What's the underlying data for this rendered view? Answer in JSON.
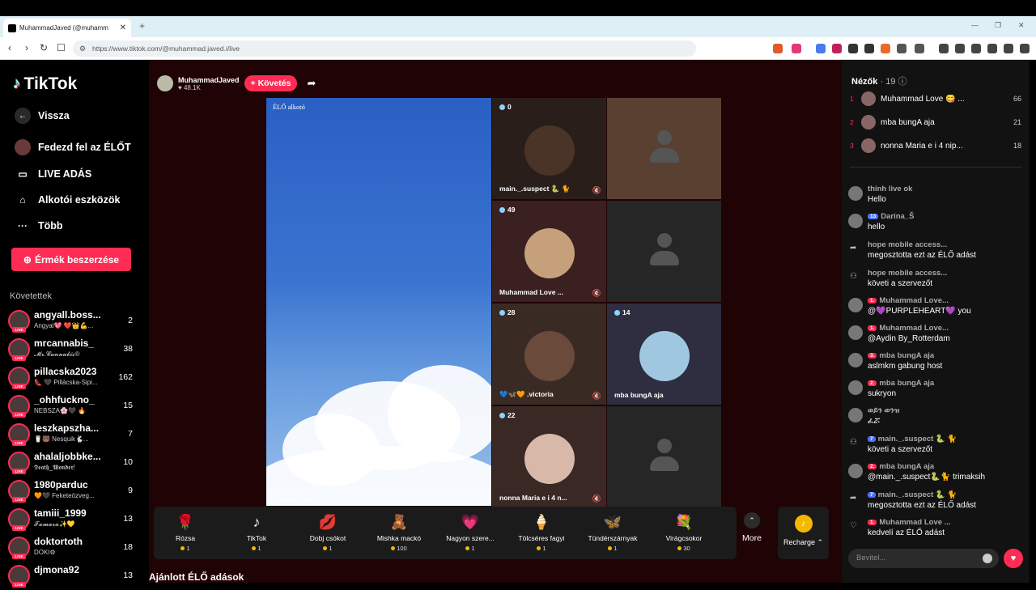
{
  "browser": {
    "tab_title": "MuhammadJaved (@muhamm",
    "url": "https://www.tiktok.com/@muhammad.javed.i/live"
  },
  "sidebar": {
    "brand": "TikTok",
    "nav": [
      "Vissza",
      "Fedezd fel az ÉLŐT",
      "LIVE ADÁS",
      "Alkotói eszközök",
      "Több"
    ],
    "coins_button": "Érmék beszerzése",
    "following_title": "Követettek",
    "following": [
      {
        "name": "angyall.boss...",
        "sub": "Angyal💖 ❤️👑💪...",
        "count": "2"
      },
      {
        "name": "mrcannabis_",
        "sub": "𝓜𝓻.𝓒𝓪𝓷𝓷𝓪𝓫𝓲𝓼®",
        "count": "38"
      },
      {
        "name": "pillacska2023",
        "sub": "👠 🖤 Pillácska-Sipi...",
        "count": "162"
      },
      {
        "name": "_ohhfuckno_",
        "sub": "NEBSZA🌸🖤 🔥",
        "count": "15"
      },
      {
        "name": "leszkapszha...",
        "sub": "🥛🐻 Nesquik🐇...",
        "count": "7"
      },
      {
        "name": "ahalaljobbke...",
        "sub": "𝕯𝖊𝖆𝖙𝖍_𝖂𝖔𝖓𝖉𝖊𝖗!",
        "count": "10"
      },
      {
        "name": "1980parduc",
        "sub": "🧡🖤 Feketeözveg...",
        "count": "9"
      },
      {
        "name": "tamiii_1999",
        "sub": "𝓣𝓪𝓶𝓪𝓻𝓪✨💛",
        "count": "13"
      },
      {
        "name": "doktortoth",
        "sub": "DOKI⚙",
        "count": "18"
      },
      {
        "name": "djmona92",
        "sub": "",
        "count": "13"
      }
    ]
  },
  "host": {
    "name": "MuhammadJaved",
    "likes": "48.1K",
    "follow_label": "+ Követés"
  },
  "stage": {
    "creator_tag": "ÉLŐ alkotó",
    "creator_name": "MuhammadJaved",
    "guests": [
      {
        "count": "0",
        "label": "main._.suspect 🐍 🐈"
      },
      {
        "count": "",
        "label": ""
      },
      {
        "count": "49",
        "label": "Muhammad Love ..."
      },
      {
        "count": "",
        "label": ""
      },
      {
        "count": "28",
        "label": "💙🦋🧡 .victoria"
      },
      {
        "count": "14",
        "label": "mba bungA aja"
      },
      {
        "count": "22",
        "label": "nonna Maria e i 4 n..."
      },
      {
        "count": "",
        "label": ""
      }
    ]
  },
  "gifts": [
    {
      "name": "Rózsa",
      "price": "1",
      "icon": "🌹"
    },
    {
      "name": "TikTok",
      "price": "1",
      "icon": "♪"
    },
    {
      "name": "Dobj csókot",
      "price": "1",
      "icon": "💋"
    },
    {
      "name": "Mishka mackó",
      "price": "100",
      "icon": "🧸"
    },
    {
      "name": "Nagyon szere...",
      "price": "1",
      "icon": "💗"
    },
    {
      "name": "Tölcséres fagyi",
      "price": "1",
      "icon": "🍦"
    },
    {
      "name": "Tündérszárnyak",
      "price": "1",
      "icon": "🦋"
    },
    {
      "name": "Virágcsokor",
      "price": "30",
      "icon": "💐"
    }
  ],
  "more_label": "More",
  "recharge_label": "Recharge",
  "recommended_title": "Ajánlott ÉLŐ adások",
  "chat": {
    "viewers_title": "Nézők",
    "viewers_count": "· 19",
    "ranking": [
      {
        "rank": "1",
        "name": "Muhammad Love 😋 ...",
        "score": "66"
      },
      {
        "rank": "2",
        "name": "mba bungA aja",
        "score": "21"
      },
      {
        "rank": "3",
        "name": "nonna Maria e i 4 nip...",
        "score": "18"
      }
    ],
    "messages": [
      {
        "user": "thinh live ok",
        "badge": "",
        "text": "Hello",
        "kind": "avatar"
      },
      {
        "user": "Darina_Š",
        "badge": "13",
        "text": "hello",
        "kind": "avatar"
      },
      {
        "user": "hope mobile access...",
        "badge": "",
        "text": "megosztotta ezt az ÉLŐ adást",
        "kind": "share"
      },
      {
        "user": "hope mobile access...",
        "badge": "",
        "text": "követi a szervezőt",
        "kind": "follow"
      },
      {
        "user": "Muhammad Love...",
        "badge": "1.",
        "text": "@💜PURPLEHEART💜 you",
        "kind": "avatar"
      },
      {
        "user": "Muhammad Love...",
        "badge": "1.",
        "text": "@Aydin By_Rotterdam",
        "kind": "avatar"
      },
      {
        "user": "mba bungA aja",
        "badge": "3.",
        "text": "aslmkm gabung host",
        "kind": "avatar"
      },
      {
        "user": "mba bungA aja",
        "badge": "2.",
        "text": "sukryon",
        "kind": "avatar"
      },
      {
        "user": "ወይን ወንዝ",
        "badge": "",
        "text": "ፈሯ",
        "kind": "avatar"
      },
      {
        "user": "main._.suspect 🐍 🐈",
        "badge": "7",
        "text": "követi a szervezőt",
        "kind": "follow"
      },
      {
        "user": "mba bungA aja",
        "badge": "2.",
        "text": "@main._.suspect🐍🐈 trimaksih",
        "kind": "avatar"
      },
      {
        "user": "main._.suspect 🐍 🐈",
        "badge": "7",
        "text": "megosztotta ezt az ÉLŐ adást",
        "kind": "share"
      },
      {
        "user": "Muhammad Love ...",
        "badge": "1.",
        "text": "kedvelí az ÉLŐ adást",
        "kind": "like"
      }
    ],
    "input_placeholder": "Bevitel..."
  }
}
